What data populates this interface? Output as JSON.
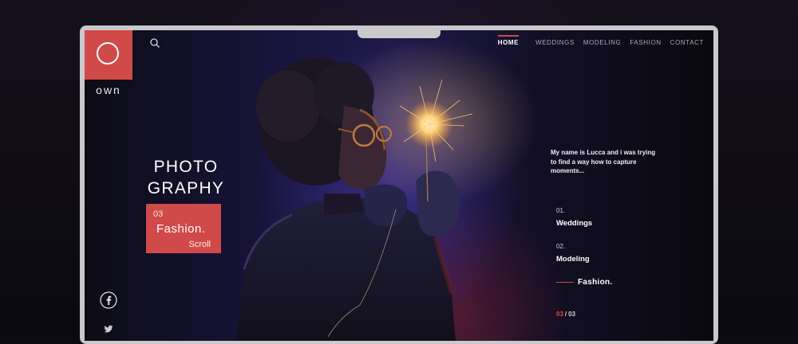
{
  "brand": {
    "logo_text": "own"
  },
  "nav": {
    "items": [
      {
        "label": "HOME",
        "active": true
      },
      {
        "label": "WEDDINGS",
        "active": false
      },
      {
        "label": "MODELING",
        "active": false
      },
      {
        "label": "FASHION",
        "active": false
      },
      {
        "label": "CONTACT",
        "active": false
      }
    ]
  },
  "hero": {
    "title_line1": "PHOTO",
    "title_line2": "GRAPHY",
    "card": {
      "number": "03",
      "title": "Fashion.",
      "scroll_label": "Scroll"
    }
  },
  "intro_text": "My name is Lucca and i was trying to find a way how to capture moments...",
  "categories": [
    {
      "number": "01.",
      "label": "Weddings"
    },
    {
      "number": "02.",
      "label": "Modeling"
    }
  ],
  "current_category": {
    "label": "Fashion."
  },
  "pager": {
    "current": "03",
    "separator": "/",
    "total": "03"
  },
  "social": {
    "icons": [
      "facebook-icon",
      "twitter-icon"
    ]
  },
  "colors": {
    "accent": "#cf4a48",
    "frame": "#c9c9cc",
    "background": "#0c0a12"
  }
}
